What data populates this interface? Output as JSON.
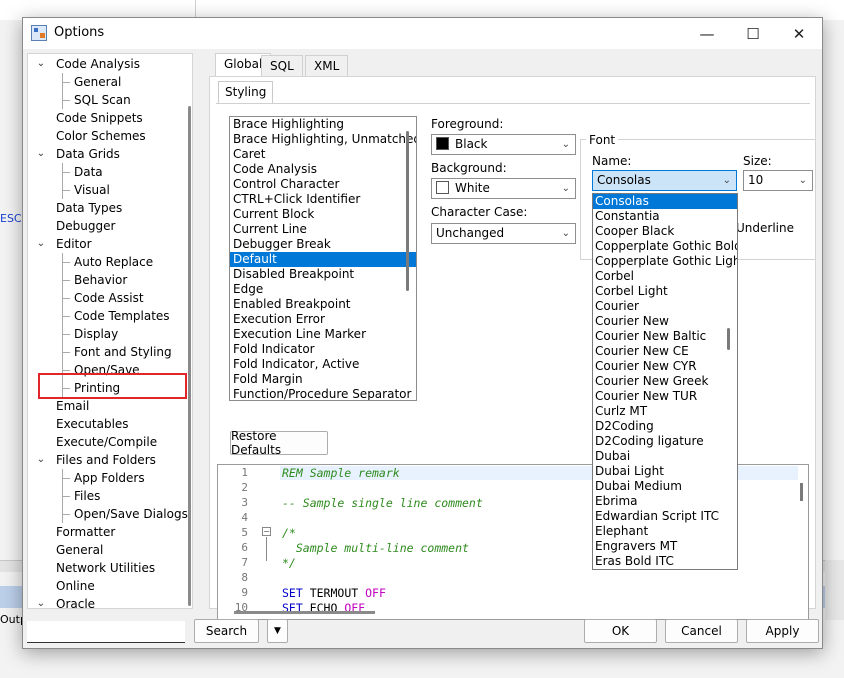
{
  "window": {
    "title": "Options",
    "minimize": "—",
    "maximize": "☐",
    "close": "✕"
  },
  "background": {
    "esc_text": "ESC",
    "output_text": "Outp"
  },
  "tree": [
    {
      "label": "Code Analysis",
      "level": 1,
      "expander": "⌄"
    },
    {
      "label": "General",
      "level": 2
    },
    {
      "label": "SQL Scan",
      "level": 2
    },
    {
      "label": "Code Snippets",
      "level": 1
    },
    {
      "label": "Color Schemes",
      "level": 1
    },
    {
      "label": "Data Grids",
      "level": 1,
      "expander": "⌄"
    },
    {
      "label": "Data",
      "level": 2
    },
    {
      "label": "Visual",
      "level": 2
    },
    {
      "label": "Data Types",
      "level": 1
    },
    {
      "label": "Debugger",
      "level": 1
    },
    {
      "label": "Editor",
      "level": 1,
      "expander": "⌄"
    },
    {
      "label": "Auto Replace",
      "level": 2
    },
    {
      "label": "Behavior",
      "level": 2
    },
    {
      "label": "Code Assist",
      "level": 2
    },
    {
      "label": "Code Templates",
      "level": 2
    },
    {
      "label": "Display",
      "level": 2
    },
    {
      "label": "Font and Styling",
      "level": 2,
      "selected": true
    },
    {
      "label": "Open/Save",
      "level": 2
    },
    {
      "label": "Printing",
      "level": 2
    },
    {
      "label": "Email",
      "level": 1
    },
    {
      "label": "Executables",
      "level": 1
    },
    {
      "label": "Execute/Compile",
      "level": 1
    },
    {
      "label": "Files and Folders",
      "level": 1,
      "expander": "⌄"
    },
    {
      "label": "App Folders",
      "level": 2
    },
    {
      "label": "Files",
      "level": 2
    },
    {
      "label": "Open/Save Dialogs",
      "level": 2
    },
    {
      "label": "Formatter",
      "level": 1
    },
    {
      "label": "General",
      "level": 1
    },
    {
      "label": "Network Utilities",
      "level": 1
    },
    {
      "label": "Online",
      "level": 1
    },
    {
      "label": "Oracle",
      "level": 1,
      "expander": "⌄"
    }
  ],
  "tabs": [
    "Global",
    "SQL",
    "XML"
  ],
  "sub_tab": "Styling",
  "style_items": [
    "Brace Highlighting",
    "Brace Highlighting, Unmatched",
    "Caret",
    "Code Analysis",
    "Control Character",
    "CTRL+Click Identifier",
    "Current Block",
    "Current Line",
    "Debugger Break",
    "Default",
    "Disabled Breakpoint",
    "Edge",
    "Enabled Breakpoint",
    "Execution Error",
    "Execution Line Marker",
    "Fold Indicator",
    "Fold Indicator, Active",
    "Fold Margin",
    "Function/Procedure Separator"
  ],
  "selected_style": "Default",
  "foreground": {
    "label": "Foreground:",
    "value": "Black",
    "swatch": "#000000"
  },
  "background_color": {
    "label": "Background:",
    "value": "White",
    "swatch": "#ffffff"
  },
  "character_case": {
    "label": "Character Case:",
    "value": "Unchanged"
  },
  "font_group": {
    "title": "Font",
    "name_label": "Name:",
    "name_value": "Consolas",
    "size_label": "Size:",
    "size_value": "10",
    "underline_label": "Underline"
  },
  "font_list": [
    "Consolas",
    "Constantia",
    "Cooper Black",
    "Copperplate Gothic Bold",
    "Copperplate Gothic Light",
    "Corbel",
    "Corbel Light",
    "Courier",
    "Courier New",
    "Courier New Baltic",
    "Courier New CE",
    "Courier New CYR",
    "Courier New Greek",
    "Courier New TUR",
    "Curlz MT",
    "D2Coding",
    "D2Coding ligature",
    "Dubai",
    "Dubai Light",
    "Dubai Medium",
    "Ebrima",
    "Edwardian Script ITC",
    "Elephant",
    "Engravers MT",
    "Eras Bold ITC"
  ],
  "restore_defaults": "Restore Defaults",
  "editor": {
    "line_numbers": [
      "1",
      "2",
      "3",
      "4",
      "5",
      "6",
      "7",
      "8",
      "9",
      "10"
    ],
    "line1": "REM Sample remark",
    "line3": "-- Sample single line comment",
    "line5": "/*",
    "line6": "  Sample multi-line comment",
    "line7": "*/",
    "line9_kw": "SET",
    "line9_mid": " TERMOUT ",
    "line9_val": "OFF",
    "line10_kw": "SET",
    "line10_mid": " ECHO ",
    "line10_val": "OFF"
  },
  "buttons": {
    "search": "Search",
    "ok": "OK",
    "cancel": "Cancel",
    "apply": "Apply",
    "search_dropdown": "▼"
  },
  "colors": {
    "accent": "#0078d7",
    "highlight_border": "#e0262b",
    "comment": "#2e8b1e",
    "keyword": "#0000c8"
  }
}
